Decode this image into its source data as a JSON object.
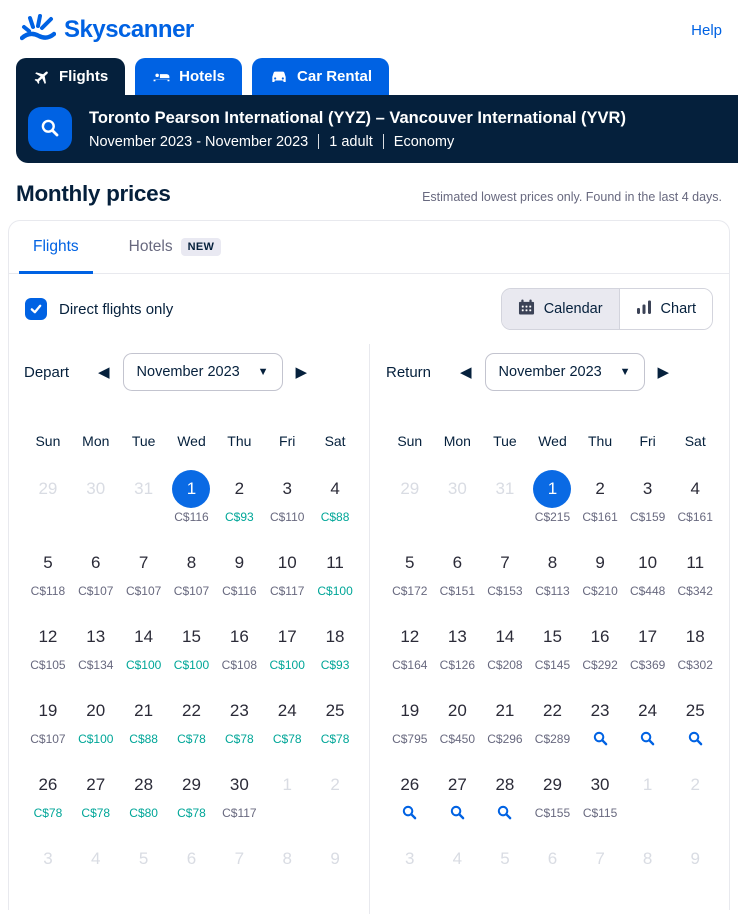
{
  "header": {
    "brand": "Skyscanner",
    "help_label": "Help"
  },
  "product_tabs": [
    {
      "label": "Flights",
      "icon": "plane-icon",
      "active": true
    },
    {
      "label": "Hotels",
      "icon": "bed-icon",
      "active": false
    },
    {
      "label": "Car Rental",
      "icon": "car-icon",
      "active": false
    }
  ],
  "search_summary": {
    "route": "Toronto Pearson International (YYZ) – Vancouver International (YVR)",
    "dates": "November 2023 - November 2023",
    "travellers": "1 adult",
    "cabin_class": "Economy"
  },
  "page": {
    "title": "Monthly prices",
    "subtitle": "Estimated lowest prices only. Found in the last 4 days."
  },
  "panel_tabs": [
    {
      "label": "Flights",
      "active": true
    },
    {
      "label": "Hotels",
      "badge": "NEW",
      "active": false
    }
  ],
  "controls": {
    "direct_only_label": "Direct flights only",
    "direct_only_checked": true,
    "view_toggle": [
      {
        "label": "Calendar",
        "icon": "calendar-icon",
        "selected": true
      },
      {
        "label": "Chart",
        "icon": "chart-icon",
        "selected": false
      }
    ]
  },
  "colors": {
    "brand_blue": "#0062e3",
    "dark_navy": "#05203c",
    "price_gray": "#68697f",
    "price_green": "#00a698",
    "muted_day": "#d9dce3"
  },
  "calendars": [
    {
      "name": "Depart",
      "month": "November 2023",
      "weekdays": [
        "Sun",
        "Mon",
        "Tue",
        "Wed",
        "Thu",
        "Fri",
        "Sat"
      ],
      "weeks": [
        [
          {
            "d": "29",
            "muted": true
          },
          {
            "d": "30",
            "muted": true
          },
          {
            "d": "31",
            "muted": true
          },
          {
            "d": "1",
            "selected": true,
            "price": "C$116",
            "tone": "gray"
          },
          {
            "d": "2",
            "price": "C$93",
            "tone": "green"
          },
          {
            "d": "3",
            "price": "C$110",
            "tone": "gray"
          },
          {
            "d": "4",
            "price": "C$88",
            "tone": "green"
          }
        ],
        [
          {
            "d": "5",
            "price": "C$118",
            "tone": "gray"
          },
          {
            "d": "6",
            "price": "C$107",
            "tone": "gray"
          },
          {
            "d": "7",
            "price": "C$107",
            "tone": "gray"
          },
          {
            "d": "8",
            "price": "C$107",
            "tone": "gray"
          },
          {
            "d": "9",
            "price": "C$116",
            "tone": "gray"
          },
          {
            "d": "10",
            "price": "C$117",
            "tone": "gray"
          },
          {
            "d": "11",
            "price": "C$100",
            "tone": "green"
          }
        ],
        [
          {
            "d": "12",
            "price": "C$105",
            "tone": "gray"
          },
          {
            "d": "13",
            "price": "C$134",
            "tone": "gray"
          },
          {
            "d": "14",
            "price": "C$100",
            "tone": "green"
          },
          {
            "d": "15",
            "price": "C$100",
            "tone": "green"
          },
          {
            "d": "16",
            "price": "C$108",
            "tone": "gray"
          },
          {
            "d": "17",
            "price": "C$100",
            "tone": "green"
          },
          {
            "d": "18",
            "price": "C$93",
            "tone": "green"
          }
        ],
        [
          {
            "d": "19",
            "price": "C$107",
            "tone": "gray"
          },
          {
            "d": "20",
            "price": "C$100",
            "tone": "green"
          },
          {
            "d": "21",
            "price": "C$88",
            "tone": "green"
          },
          {
            "d": "22",
            "price": "C$78",
            "tone": "green"
          },
          {
            "d": "23",
            "price": "C$78",
            "tone": "green"
          },
          {
            "d": "24",
            "price": "C$78",
            "tone": "green"
          },
          {
            "d": "25",
            "price": "C$78",
            "tone": "green"
          }
        ],
        [
          {
            "d": "26",
            "price": "C$78",
            "tone": "green"
          },
          {
            "d": "27",
            "price": "C$78",
            "tone": "green"
          },
          {
            "d": "28",
            "price": "C$80",
            "tone": "green"
          },
          {
            "d": "29",
            "price": "C$78",
            "tone": "green"
          },
          {
            "d": "30",
            "price": "C$117",
            "tone": "gray"
          },
          {
            "d": "1",
            "muted": true
          },
          {
            "d": "2",
            "muted": true
          }
        ],
        [
          {
            "d": "3",
            "muted": true
          },
          {
            "d": "4",
            "muted": true
          },
          {
            "d": "5",
            "muted": true
          },
          {
            "d": "6",
            "muted": true
          },
          {
            "d": "7",
            "muted": true
          },
          {
            "d": "8",
            "muted": true
          },
          {
            "d": "9",
            "muted": true
          }
        ]
      ]
    },
    {
      "name": "Return",
      "month": "November 2023",
      "weekdays": [
        "Sun",
        "Mon",
        "Tue",
        "Wed",
        "Thu",
        "Fri",
        "Sat"
      ],
      "weeks": [
        [
          {
            "d": "29",
            "muted": true
          },
          {
            "d": "30",
            "muted": true
          },
          {
            "d": "31",
            "muted": true
          },
          {
            "d": "1",
            "selected": true,
            "price": "C$215",
            "tone": "gray"
          },
          {
            "d": "2",
            "price": "C$161",
            "tone": "gray"
          },
          {
            "d": "3",
            "price": "C$159",
            "tone": "gray"
          },
          {
            "d": "4",
            "price": "C$161",
            "tone": "gray"
          }
        ],
        [
          {
            "d": "5",
            "price": "C$172",
            "tone": "gray"
          },
          {
            "d": "6",
            "price": "C$151",
            "tone": "gray"
          },
          {
            "d": "7",
            "price": "C$153",
            "tone": "gray"
          },
          {
            "d": "8",
            "price": "C$113",
            "tone": "gray"
          },
          {
            "d": "9",
            "price": "C$210",
            "tone": "gray"
          },
          {
            "d": "10",
            "price": "C$448",
            "tone": "gray"
          },
          {
            "d": "11",
            "price": "C$342",
            "tone": "gray"
          }
        ],
        [
          {
            "d": "12",
            "price": "C$164",
            "tone": "gray"
          },
          {
            "d": "13",
            "price": "C$126",
            "tone": "gray"
          },
          {
            "d": "14",
            "price": "C$208",
            "tone": "gray"
          },
          {
            "d": "15",
            "price": "C$145",
            "tone": "gray"
          },
          {
            "d": "16",
            "price": "C$292",
            "tone": "gray"
          },
          {
            "d": "17",
            "price": "C$369",
            "tone": "gray"
          },
          {
            "d": "18",
            "price": "C$302",
            "tone": "gray"
          }
        ],
        [
          {
            "d": "19",
            "price": "C$795",
            "tone": "gray"
          },
          {
            "d": "20",
            "price": "C$450",
            "tone": "gray"
          },
          {
            "d": "21",
            "price": "C$296",
            "tone": "gray"
          },
          {
            "d": "22",
            "price": "C$289",
            "tone": "gray"
          },
          {
            "d": "23",
            "icon": "search-icon"
          },
          {
            "d": "24",
            "icon": "search-icon"
          },
          {
            "d": "25",
            "icon": "search-icon"
          }
        ],
        [
          {
            "d": "26",
            "icon": "search-icon"
          },
          {
            "d": "27",
            "icon": "search-icon"
          },
          {
            "d": "28",
            "icon": "search-icon"
          },
          {
            "d": "29",
            "price": "C$155",
            "tone": "gray"
          },
          {
            "d": "30",
            "price": "C$115",
            "tone": "gray"
          },
          {
            "d": "1",
            "muted": true
          },
          {
            "d": "2",
            "muted": true
          }
        ],
        [
          {
            "d": "3",
            "muted": true
          },
          {
            "d": "4",
            "muted": true
          },
          {
            "d": "5",
            "muted": true
          },
          {
            "d": "6",
            "muted": true
          },
          {
            "d": "7",
            "muted": true
          },
          {
            "d": "8",
            "muted": true
          },
          {
            "d": "9",
            "muted": true
          }
        ]
      ]
    }
  ]
}
